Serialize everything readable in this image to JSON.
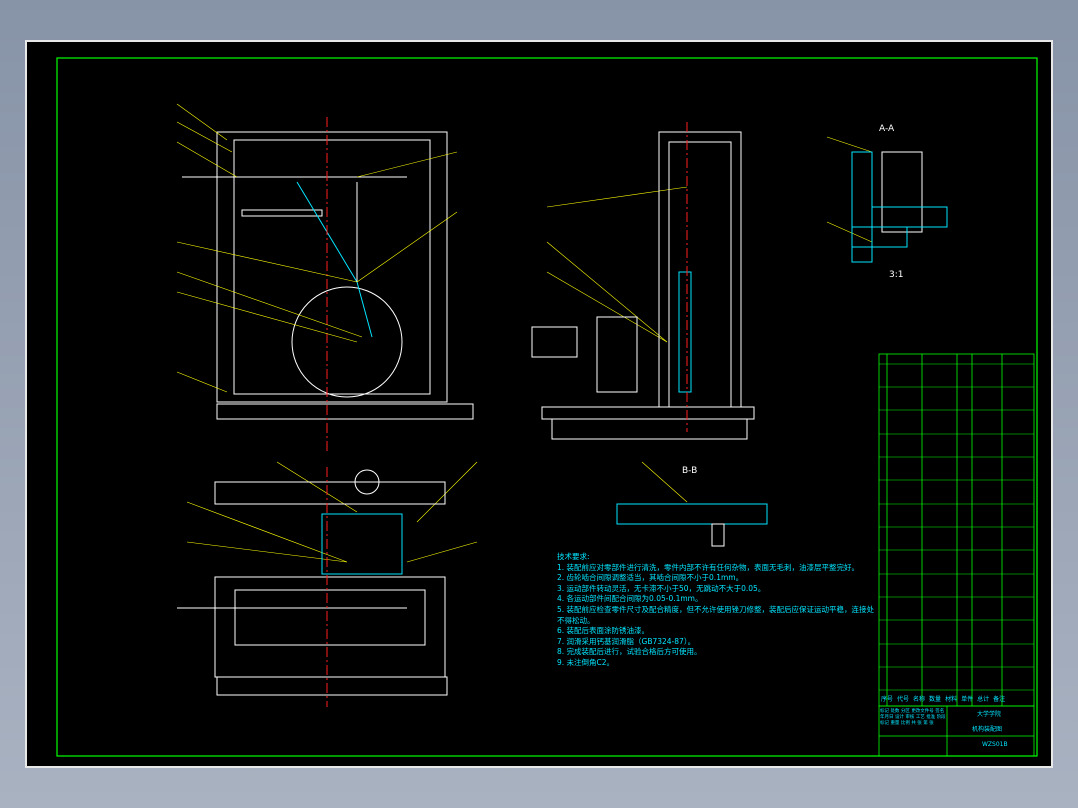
{
  "colors": {
    "frame": "#00ff00",
    "outline": "#ffffff",
    "section": "#00e5ff",
    "leader": "#ffff00",
    "center": "#ff2020"
  },
  "views": {
    "section_aa": "A-A",
    "section_bb": "B-B",
    "scale_note": "3:1"
  },
  "notes": {
    "title": "技术要求:",
    "items": [
      "1. 装配前应对零部件进行清洗，零件内部不许有任何杂物，表面无毛刺，油漆层平整完好。",
      "2. 齿轮啮合间隙调整适当，其啮合间隙不小于0.1mm。",
      "3. 运动部件转动灵活，无卡滞不小于50，无跳动不大于0.05。",
      "4. 各运动部件间配合间隙为0.05-0.1mm。",
      "5. 装配前应检查零件尺寸及配合精度，但不允许使用锉刀修整，装配后应保证运动平稳，连接处",
      "不得松动。",
      "6. 装配后表面涂防锈油漆。",
      "7. 润滑采用钙基润滑脂（GB7324-87）。",
      "8. 完成装配后进行，试验合格后方可使用。",
      "9. 未注倒角C2。"
    ]
  },
  "title_block": {
    "headers": [
      "序号",
      "代号",
      "名称",
      "数量",
      "材料",
      "单件",
      "总计",
      "备注"
    ],
    "school": "大学学院",
    "drawing_name": "机构装配图",
    "drawing_no": "WZS01B",
    "labels": [
      "标记",
      "处数",
      "分区",
      "更改文件号",
      "签名",
      "年月日",
      "设计",
      "审核",
      "工艺",
      "批准",
      "阶段标记",
      "重量",
      "比例",
      "共 张",
      "第 张"
    ]
  }
}
